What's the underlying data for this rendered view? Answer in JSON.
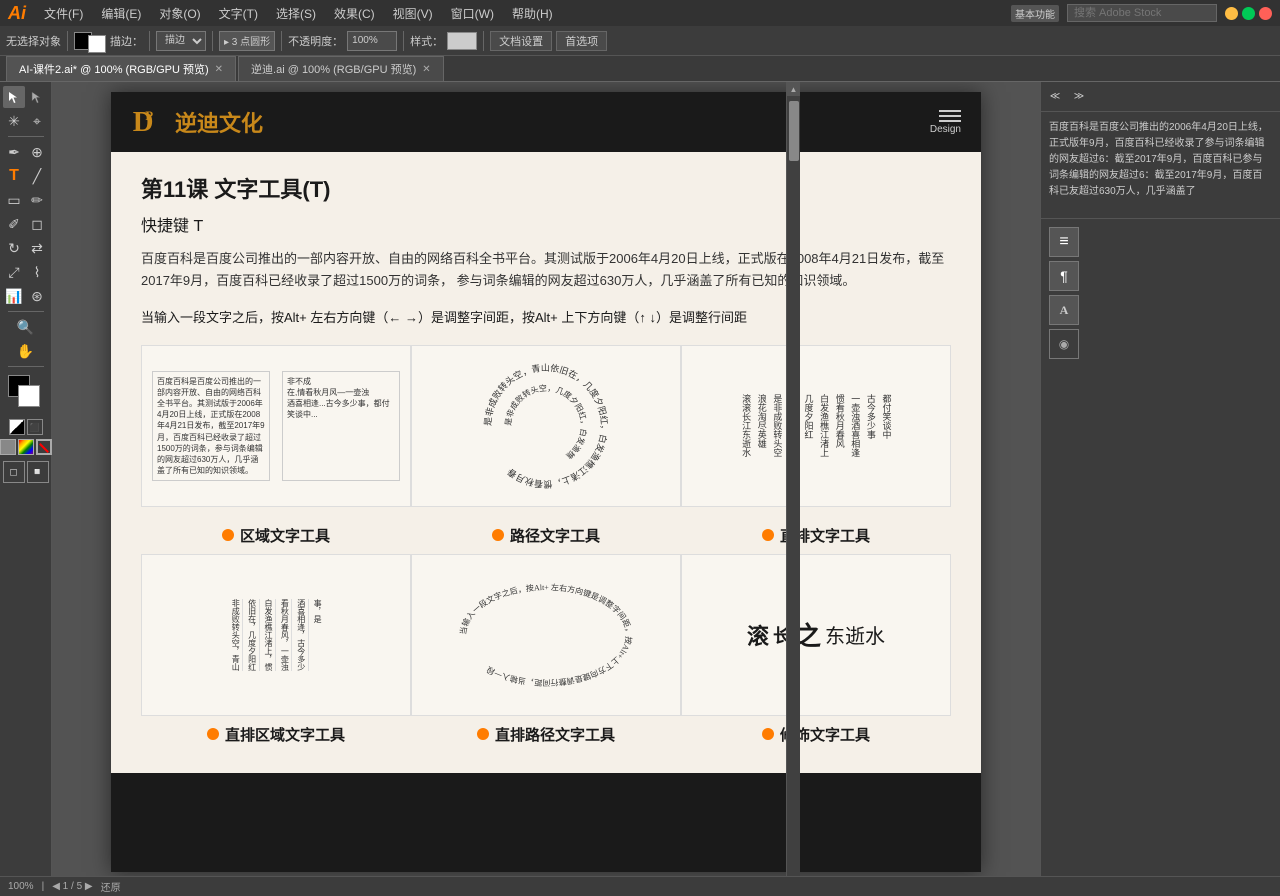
{
  "app": {
    "logo": "Ai",
    "title": "Adobe Illustrator"
  },
  "menu": {
    "items": [
      "文件(F)",
      "编辑(E)",
      "对象(O)",
      "文字(T)",
      "选择(S)",
      "效果(C)",
      "视图(V)",
      "窗口(W)",
      "帮助(H)"
    ],
    "right_label": "基本功能",
    "search_placeholder": "搜索 Adobe Stock"
  },
  "toolbar": {
    "no_select": "无选择对象",
    "stroke_label": "描边：",
    "point_label": "▸ 3 点圆形",
    "opacity_label": "不透明度：",
    "opacity_value": "100%",
    "style_label": "样式：",
    "doc_settings": "文档设置",
    "preferences": "首选项"
  },
  "tabs": [
    {
      "label": "AI-课件2.ai* @ 100% (RGB/GPU 预览)",
      "active": true
    },
    {
      "label": "逆迪.ai @ 100% (RGB/GPU 预览)",
      "active": false
    }
  ],
  "canvas": {
    "logo_chinese": "逆迪文化",
    "design_label": "Design",
    "lesson_title": "第11课   文字工具(T)",
    "shortcut": "快捷键 T",
    "description": "百度百科是百度公司推出的一部内容开放、自由的网络百科全书平台。其测试版于2006年4月20日上线，正式版在2008年4月21日发布，截至2017年9月，百度百科已经收录了超过1500万的词条，\n参与词条编辑的网友超过630万人，几乎涵盖了所有已知的知识领域。",
    "tip": "当输入一段文字之后，按Alt+ 左右方向键（← →）是调整字间距，按Alt+ 上下方向键（↑ ↓）是调整行间距",
    "tools": [
      {
        "dot": true,
        "label": "区域文字工具"
      },
      {
        "dot": true,
        "label": "路径文字工具"
      },
      {
        "dot": true,
        "label": "直排文字工具"
      }
    ],
    "tools_bottom": [
      {
        "dot": true,
        "label": "直排区域文字工具"
      },
      {
        "dot": true,
        "label": "直排路径文字工具"
      },
      {
        "dot": true,
        "label": "修饰文字工具"
      }
    ],
    "demo_text_block": "百度百科是百度公司推出的一部内容开放、自由的网络百科全书平台。其测试版于2006年4月20日上线，正式版在2008年4月21日发布，截至2017年9月，百度百科已经收录了超过1500万的词条，参与词条编辑的网友超过630万人，几乎涵盖了所有已知的知识领域。",
    "demo_poem": "非成败转头空，青山依旧在，几度夕阳红，白发渔樵江渚上，惯看秋月春风，一壶浊酒喜相逢，古今多少事，都付笑谈中",
    "right_panel_text": "百度百科是百度公司推出的2006年4月20日上线，正式版年9月，百度百科已经收录了参与词条编辑的网友超过6：截至2017年9月，百度百科已参与词条编辑的网友超过6：截至2017年9月，百度百科已友超过630万人，几乎涵盖了"
  },
  "status": {
    "zoom": "100%",
    "page": "1",
    "pages": "5"
  }
}
